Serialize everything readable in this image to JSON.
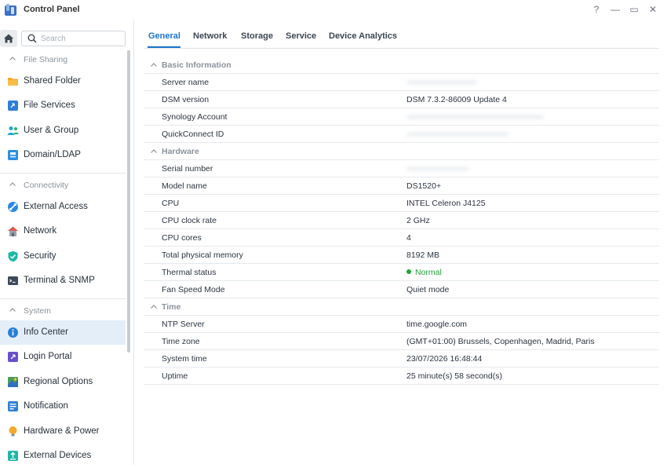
{
  "window": {
    "title": "Control Panel",
    "controls": [
      "help-icon",
      "minimize-icon",
      "maximize-icon",
      "close-icon"
    ],
    "help_glyph": "?",
    "minimize_glyph": "—",
    "maximize_glyph": "▭",
    "close_glyph": "✕"
  },
  "sidebar": {
    "search_placeholder": "Search",
    "sections": [
      {
        "label": "File Sharing",
        "items": [
          {
            "label": "Shared Folder",
            "icon": "shared-folder-icon"
          },
          {
            "label": "File Services",
            "icon": "file-services-icon"
          },
          {
            "label": "User & Group",
            "icon": "user-group-icon"
          },
          {
            "label": "Domain/LDAP",
            "icon": "domain-ldap-icon"
          }
        ]
      },
      {
        "label": "Connectivity",
        "items": [
          {
            "label": "External Access",
            "icon": "external-access-icon"
          },
          {
            "label": "Network",
            "icon": "network-icon"
          },
          {
            "label": "Security",
            "icon": "security-shield-icon"
          },
          {
            "label": "Terminal & SNMP",
            "icon": "terminal-icon"
          }
        ]
      },
      {
        "label": "System",
        "items": [
          {
            "label": "Info Center",
            "icon": "info-center-icon",
            "active": true
          },
          {
            "label": "Login Portal",
            "icon": "login-portal-icon"
          },
          {
            "label": "Regional Options",
            "icon": "regional-options-icon"
          },
          {
            "label": "Notification",
            "icon": "notification-icon"
          },
          {
            "label": "Hardware & Power",
            "icon": "hardware-power-icon"
          },
          {
            "label": "External Devices",
            "icon": "external-devices-icon"
          }
        ]
      }
    ]
  },
  "tabs": [
    {
      "label": "General",
      "active": true
    },
    {
      "label": "Network"
    },
    {
      "label": "Storage"
    },
    {
      "label": "Service"
    },
    {
      "label": "Device Analytics"
    }
  ],
  "info": {
    "basic": {
      "header": "Basic Information",
      "server_name_label": "Server name",
      "dsm_version_label": "DSM version",
      "dsm_version": "DSM 7.3.2-86009 Update 4",
      "synology_account_label": "Synology Account",
      "quickconnect_label": "QuickConnect ID"
    },
    "hardware": {
      "header": "Hardware",
      "serial_label": "Serial number",
      "model_label": "Model name",
      "model": "DS1520+",
      "cpu_label": "CPU",
      "cpu": "INTEL Celeron J4125",
      "clock_label": "CPU clock rate",
      "clock": "2 GHz",
      "cores_label": "CPU cores",
      "cores": "4",
      "memory_label": "Total physical memory",
      "memory": "8192 MB",
      "thermal_label": "Thermal status",
      "thermal": "Normal",
      "fan_label": "Fan Speed Mode",
      "fan": "Quiet mode"
    },
    "time": {
      "header": "Time",
      "ntp_label": "NTP Server",
      "ntp": "time.google.com",
      "tz_label": "Time zone",
      "tz": "(GMT+01:00) Brussels, Copenhagen, Madrid, Paris",
      "systime_label": "System time",
      "systime": "23/07/2026 16:48:44",
      "uptime_label": "Uptime",
      "uptime": "25 minute(s) 58 second(s)"
    }
  },
  "colors": {
    "accent": "#1a73c8",
    "status_ok": "#22a33a",
    "active_nav_bg": "#e4eef8"
  }
}
